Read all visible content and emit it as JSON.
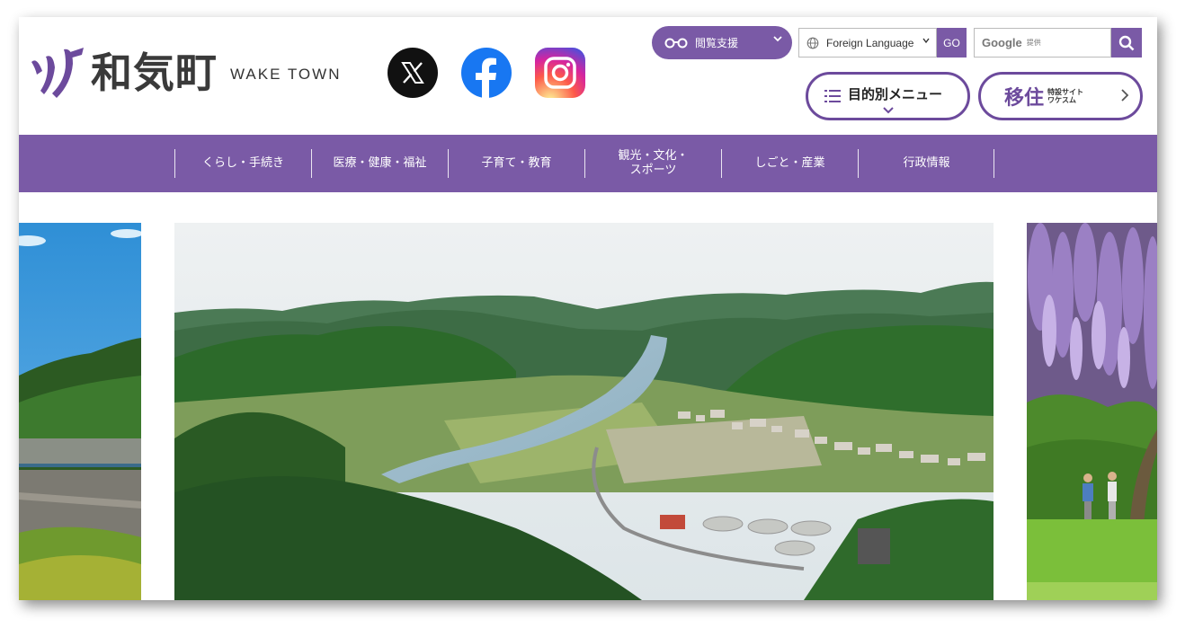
{
  "header": {
    "logo_jp": "和気町",
    "logo_en": "WAKE TOWN"
  },
  "social": [
    {
      "name": "X",
      "icon": "x-icon"
    },
    {
      "name": "Facebook",
      "icon": "facebook-icon"
    },
    {
      "name": "Instagram",
      "icon": "instagram-icon"
    }
  ],
  "tools": {
    "reading_support": "閲覧支援",
    "foreign_language": "Foreign Language",
    "go": "GO",
    "search_google": "Google",
    "search_provided": "提供"
  },
  "buttons": {
    "purpose_menu": "目的別メニュー",
    "migration_big": "移住",
    "migration_small_1": "特設サイト",
    "migration_small_2": "ワケスム"
  },
  "nav": [
    {
      "label": "くらし・手続き"
    },
    {
      "label": "医療・健康・福祉"
    },
    {
      "label": "子育て・教育"
    },
    {
      "label": "観光・文化・\nスポーツ"
    },
    {
      "label": "しごと・産業"
    },
    {
      "label": "行政情報"
    }
  ],
  "colors": {
    "brand_purple": "#7a5aa6",
    "outline_purple": "#6c4a9c"
  }
}
